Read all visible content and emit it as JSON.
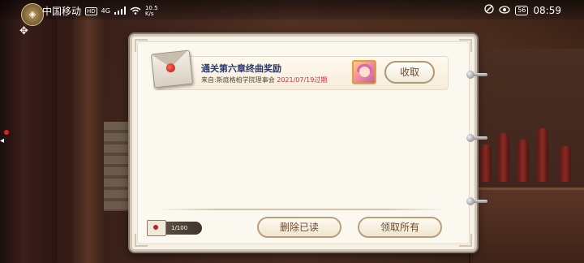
{
  "status_bar": {
    "carrier": "中国移动",
    "hd_badge": "HD",
    "network": "4G",
    "signal_icon": "signal-bars-icon",
    "wifi_icon": "wifi-icon",
    "speed_value": "10.5",
    "speed_unit": "K/s",
    "battery": "56",
    "time": "08:59"
  },
  "mail": {
    "items": [
      {
        "title": "通关第六章终曲奖励",
        "sender": "来自:斯庭格柏学院理事会",
        "expiry": "2021/07/19过期",
        "reward_icon": "character-portrait-icon",
        "action_label": "收取"
      }
    ],
    "counter": "1/100",
    "delete_read_label": "删除已读",
    "claim_all_label": "领取所有"
  },
  "colors": {
    "title": "#2a3a70",
    "expiry": "#d0303a",
    "panel_bg": "#f6f1e6",
    "button_text": "#6a4a2e"
  }
}
